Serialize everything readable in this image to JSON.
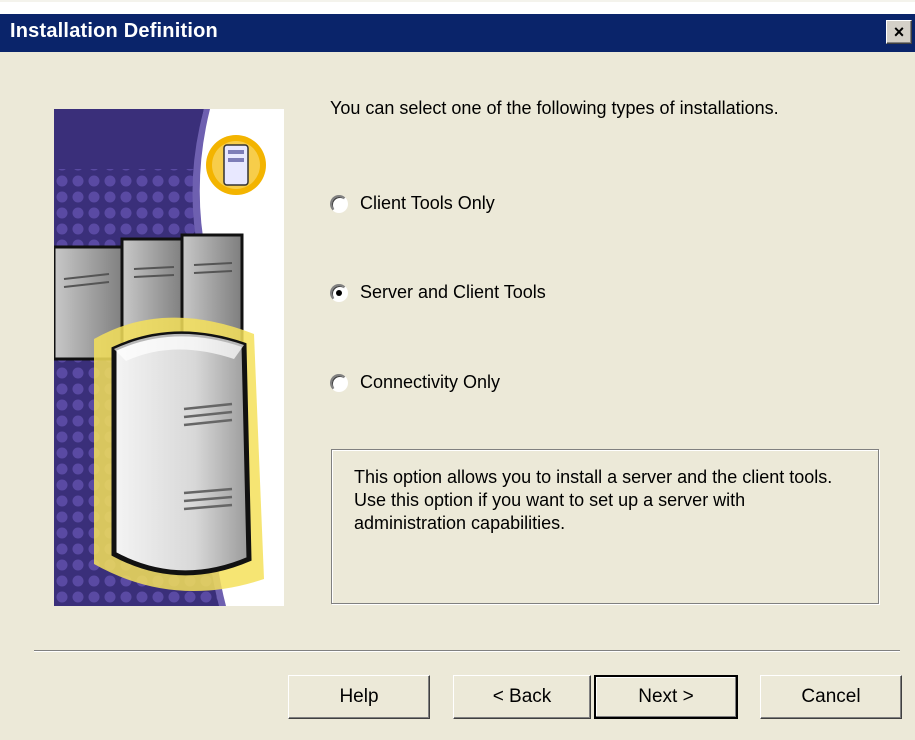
{
  "window": {
    "title": "Installation Definition",
    "close_glyph": "×"
  },
  "intro_text": "You can select one of the following types of installations.",
  "options": [
    {
      "label": "Client Tools Only",
      "selected": false
    },
    {
      "label": "Server and Client Tools",
      "selected": true
    },
    {
      "label": "Connectivity Only",
      "selected": false
    }
  ],
  "description": "This option allows you to install a server and the client tools. Use this option if you want to set up a server with administration capabilities.",
  "buttons": {
    "help": "Help",
    "back": "< Back",
    "next": "Next >",
    "cancel": "Cancel"
  },
  "colors": {
    "titlebar": "#0a246a",
    "dialog_bg": "#ece9d8",
    "illustration_bg": "#3a2f7a",
    "illustration_glow": "#f5e05a",
    "badge": "#f3b400"
  }
}
